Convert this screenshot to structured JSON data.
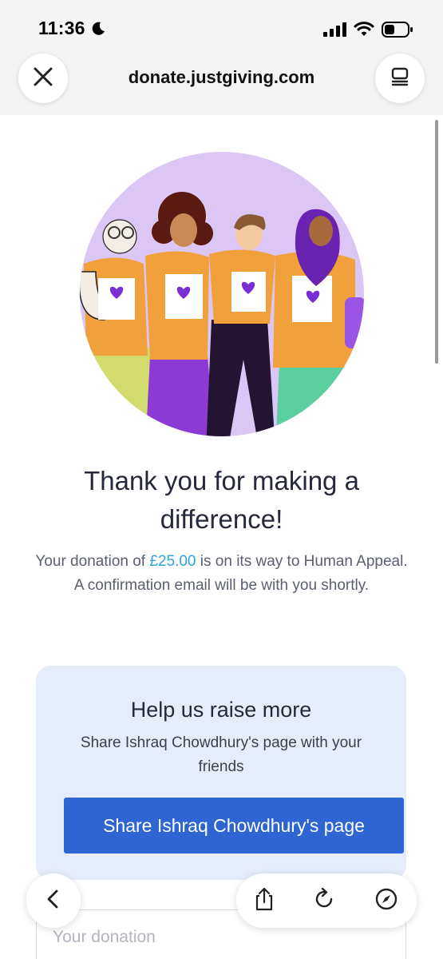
{
  "status": {
    "time": "11:36"
  },
  "browser": {
    "url": "donate.justgiving.com"
  },
  "thanks": {
    "heading_line1": "Thank you for making a",
    "heading_line2": "difference!",
    "donation_prefix": "Your donation of ",
    "amount": "£25.00",
    "donation_suffix": " is on its way to Human Appeal.",
    "email_note": "A confirmation email will be with you shortly."
  },
  "share": {
    "title": "Help us raise more",
    "description": "Share Ishraq Chowdhury's page with your friends",
    "button_label": "Share Ishraq Chowdhury's page"
  },
  "donation": {
    "label": "Your donation"
  },
  "icons": {
    "moon": "moon-icon",
    "signal": "cellular-signal-icon",
    "wifi": "wifi-icon",
    "battery": "battery-icon",
    "close": "close-icon",
    "reader": "tabs-overview-icon",
    "back": "chevron-left-icon",
    "share": "share-icon",
    "reload": "reload-icon",
    "compass": "compass-icon"
  },
  "colors": {
    "accent_blue": "#2f65d3",
    "amount_blue": "#2fa2d9",
    "card_bg": "#e6edfa",
    "illustration_bg": "#dcc6f5",
    "shirt_orange": "#f0a13c",
    "heart_purple": "#7a2ed6"
  }
}
